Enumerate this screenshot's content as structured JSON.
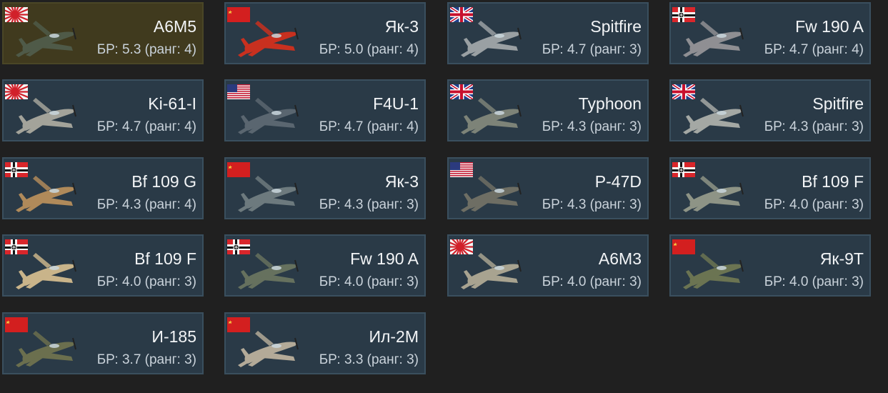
{
  "cards": [
    {
      "name": "A6M5",
      "br": "БР: 5.3 (ранг: 4)",
      "flag_icon": "japan-flag-icon",
      "plane_icon": "a6m5-aircraft-icon",
      "nation": "japan",
      "selected": true,
      "plane_color": "#4f5a48"
    },
    {
      "name": "Як-3",
      "br": "БР: 5.0 (ранг: 4)",
      "flag_icon": "ussr-flag-icon",
      "plane_icon": "yak-3-aircraft-icon",
      "nation": "ussr",
      "selected": false,
      "plane_color": "#c8301f"
    },
    {
      "name": "Spitfire",
      "br": "БР: 4.7 (ранг: 3)",
      "flag_icon": "uk-flag-icon",
      "plane_icon": "spitfire-aircraft-icon",
      "nation": "uk",
      "selected": false,
      "plane_color": "#9aa0a3"
    },
    {
      "name": "Fw 190 A",
      "br": "БР: 4.7 (ранг: 4)",
      "flag_icon": "germany-flag-icon",
      "plane_icon": "fw-190-a-aircraft-icon",
      "nation": "germany",
      "selected": false,
      "plane_color": "#8f8f93"
    },
    {
      "name": "Ki-61-I",
      "br": "БР: 4.7 (ранг: 4)",
      "flag_icon": "japan-flag-icon",
      "plane_icon": "ki-61-i-aircraft-icon",
      "nation": "japan",
      "selected": false,
      "plane_color": "#a3a39a"
    },
    {
      "name": "F4U-1",
      "br": "БР: 4.7 (ранг: 4)",
      "flag_icon": "usa-flag-icon",
      "plane_icon": "f4u-1-aircraft-icon",
      "nation": "usa",
      "selected": false,
      "plane_color": "#5a6670"
    },
    {
      "name": "Typhoon",
      "br": "БР: 4.3 (ранг: 3)",
      "flag_icon": "uk-flag-icon",
      "plane_icon": "typhoon-aircraft-icon",
      "nation": "uk",
      "selected": false,
      "plane_color": "#7d8378"
    },
    {
      "name": "Spitfire",
      "br": "БР: 4.3 (ранг: 3)",
      "flag_icon": "uk-flag-icon",
      "plane_icon": "spitfire-aircraft-icon",
      "nation": "uk",
      "selected": false,
      "plane_color": "#a4a8a4"
    },
    {
      "name": "Bf 109 G",
      "br": "БР: 4.3 (ранг: 4)",
      "flag_icon": "germany-flag-icon",
      "plane_icon": "bf-109-g-aircraft-icon",
      "nation": "germany",
      "selected": false,
      "plane_color": "#b08a5a"
    },
    {
      "name": "Як-3",
      "br": "БР: 4.3 (ранг: 3)",
      "flag_icon": "ussr-flag-icon",
      "plane_icon": "yak-3-aircraft-icon",
      "nation": "ussr",
      "selected": false,
      "plane_color": "#6d7a7e"
    },
    {
      "name": "P-47D",
      "br": "БР: 4.3 (ранг: 3)",
      "flag_icon": "usa-flag-icon",
      "plane_icon": "p-47d-aircraft-icon",
      "nation": "usa",
      "selected": false,
      "plane_color": "#6e6e64"
    },
    {
      "name": "Bf 109 F",
      "br": "БР: 4.0 (ранг: 3)",
      "flag_icon": "germany-flag-icon",
      "plane_icon": "bf-109-f-aircraft-icon",
      "nation": "germany",
      "selected": false,
      "plane_color": "#8e9486"
    },
    {
      "name": "Bf 109 F",
      "br": "БР: 4.0 (ранг: 3)",
      "flag_icon": "germany-flag-icon",
      "plane_icon": "bf-109-f-aircraft-icon",
      "nation": "germany",
      "selected": false,
      "plane_color": "#c9b48a"
    },
    {
      "name": "Fw 190 A",
      "br": "БР: 4.0 (ранг: 3)",
      "flag_icon": "germany-flag-icon",
      "plane_icon": "fw-190-a-aircraft-icon",
      "nation": "germany",
      "selected": false,
      "plane_color": "#66715e"
    },
    {
      "name": "A6M3",
      "br": "БР: 4.0 (ранг: 3)",
      "flag_icon": "japan-flag-icon",
      "plane_icon": "a6m3-aircraft-icon",
      "nation": "japan",
      "selected": false,
      "plane_color": "#a8a390"
    },
    {
      "name": "Як-9Т",
      "br": "БР: 4.0 (ранг: 3)",
      "flag_icon": "ussr-flag-icon",
      "plane_icon": "yak-9t-aircraft-icon",
      "nation": "ussr",
      "selected": false,
      "plane_color": "#6b7452"
    },
    {
      "name": "И-185",
      "br": "БР: 3.7 (ранг: 3)",
      "flag_icon": "ussr-flag-icon",
      "plane_icon": "i-185-aircraft-icon",
      "nation": "ussr",
      "selected": false,
      "plane_color": "#6b6f4e"
    },
    {
      "name": "Ил-2М",
      "br": "БР: 3.3 (ранг: 3)",
      "flag_icon": "ussr-flag-icon",
      "plane_icon": "il-2m-aircraft-icon",
      "nation": "ussr",
      "selected": false,
      "plane_color": "#b3aa98"
    }
  ],
  "colors": {
    "page_bg": "#202020",
    "card_bg": "#2a3a47",
    "card_border": "#3a4f5e",
    "selected_bg": "#403a1e",
    "name_text": "#f2f4f6",
    "br_text": "#c9d2da"
  }
}
